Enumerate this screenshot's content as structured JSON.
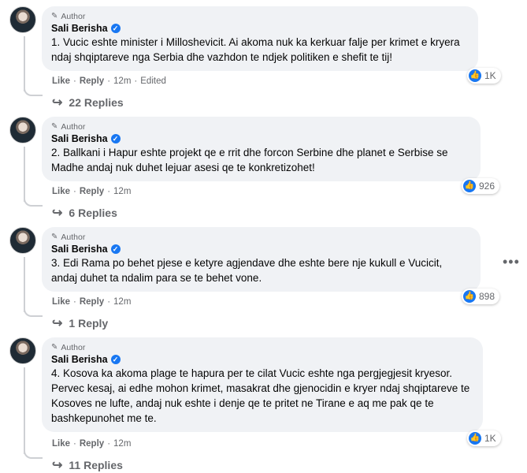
{
  "comments": [
    {
      "badge": "Author",
      "name": "Sali Berisha",
      "text": "1. Vucic eshte minister i Millosheviсit. Ai akoma nuk ka kerkuar falje per krimet e kryera ndaj shqiptareve nga Serbia dhe vazhdon te ndjek politiken e shefit te tij!",
      "like": "Like",
      "reply": "Reply",
      "time": "12m",
      "edited": "Edited",
      "reactions": "1K",
      "replies": "22 Replies"
    },
    {
      "badge": "Author",
      "name": "Sali Berisha",
      "text": "2. Ballkani i Hapur eshte projekt qe e rrit dhe forcon Serbine dhe planet e Serbise se Madhe andaj nuk duhet lejuar asesi qe te konkretizohet!",
      "like": "Like",
      "reply": "Reply",
      "time": "12m",
      "reactions": "926",
      "replies": "6 Replies"
    },
    {
      "badge": "Author",
      "name": "Sali Berisha",
      "text": "3. Edi Rama po behet pjese e ketyre agjendave dhe eshte bere nje kukull e Vucicit, andaj duhet ta ndalim para se te behet vone.",
      "like": "Like",
      "reply": "Reply",
      "time": "12m",
      "reactions": "898",
      "replies": "1 Reply"
    },
    {
      "badge": "Author",
      "name": "Sali Berisha",
      "text": "4. Kosova ka akoma plage te hapura per te cilat Vucic eshte nga pergjegjesit kryesor. Pervec kesaj, ai edhe mohon krimet, masakrat dhe gjenocidin e kryer ndaj shqiptareve te Kosoves ne lufte, andaj nuk eshte i denje qe te pritet ne Tirane e aq me pak qe te bashkepunohet me te.",
      "like": "Like",
      "reply": "Reply",
      "time": "12m",
      "reactions": "1K",
      "replies": "11 Replies"
    }
  ],
  "separator": "·",
  "more_icon": "more-horizontal-icon",
  "colors": {
    "accent": "#1877f2",
    "bubble": "#f0f2f5",
    "muted": "#65676b"
  }
}
